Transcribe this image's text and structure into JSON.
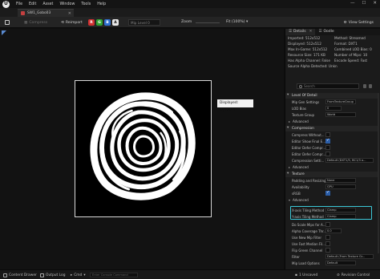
{
  "menubar": {
    "items": [
      "File",
      "Edit",
      "Asset",
      "Window",
      "Tools",
      "Help"
    ],
    "window_controls": [
      "—",
      "☐",
      "✕"
    ]
  },
  "tab": {
    "title": "SW1_Gobo03",
    "close": "✕"
  },
  "toolbar": {
    "save_icon": "save-icon",
    "compress_label": "Compress",
    "reimport_label": "Reimport",
    "channels": [
      {
        "label": "R",
        "color": "#d03030"
      },
      {
        "label": "G",
        "color": "#30a030"
      },
      {
        "label": "B",
        "color": "#2f6fd0"
      },
      {
        "label": "A",
        "color": "#e8e8e8"
      }
    ],
    "mip_placeholder": "Mip Level 0",
    "zoom_label": "Zoom",
    "zoom_value": "Fit (100%)",
    "view_settings_label": "View Settings"
  },
  "viewport": {
    "displayed_tag": "Displayed: 512x512"
  },
  "panel": {
    "tabs": [
      {
        "label": "Details",
        "active": true
      },
      {
        "label": "Oodle",
        "active": false
      }
    ],
    "info_lines": [
      "Imported: 512x512",
      "Method: Streamed",
      "Displayed: 512x512",
      "Format: DXT1",
      "Max In-Game: 512x512",
      "Combined LOD Bias: 0",
      "Resource Size: 171 KB",
      "Number of Mips: 10",
      "Has Alpha Channel: False",
      "Encode Speed: Fast",
      "Source Alpha Detected: Unkn"
    ],
    "search_placeholder": "Search",
    "sections": {
      "lod": "Level Of Detail",
      "compression": "Compression",
      "texture": "Texture"
    },
    "lod_props": [
      {
        "label": "Mip Gen Settings",
        "value": "FromTextureGroup"
      },
      {
        "label": "LOD Bias",
        "value": "0"
      },
      {
        "label": "Texture Group",
        "value": "World"
      }
    ],
    "advanced_label": "Advanced",
    "compression_props": [
      {
        "label": "Compress Without...",
        "checked": false
      },
      {
        "label": "Editor Show Final E...",
        "checked": true
      },
      {
        "label": "Editor Defer Compr...",
        "checked": false
      },
      {
        "label": "Editor Defer Compr...",
        "checked": false
      }
    ],
    "compression_settings": {
      "label": "Compression Setti...",
      "value": "Default (DXT1/5, BC1/3 o..."
    },
    "texture_props": [
      {
        "label": "Padding and Resizing",
        "value": "None"
      },
      {
        "label": "Availability",
        "value": "GPU"
      }
    ],
    "srgb": {
      "label": "sRGB",
      "checked": true
    },
    "tiling": [
      {
        "label": "X-axis Tiling Method",
        "value": "Clamp"
      },
      {
        "label": "Y-axis Tiling Method",
        "value": "Clamp"
      }
    ],
    "bottom_props": [
      {
        "label": "Do Scale Mips for A...",
        "type": "check",
        "checked": false
      },
      {
        "label": "Alpha Coverage Thr...",
        "type": "text",
        "value": "0.0"
      },
      {
        "label": "Use New Mip Filter",
        "type": "check",
        "checked": false
      },
      {
        "label": "Use Fast Median Fil...",
        "type": "check",
        "checked": false
      },
      {
        "label": "Flip Green Channel",
        "type": "check",
        "checked": false
      },
      {
        "label": "Filter",
        "type": "text",
        "value": "Default (From Texture Gr..."
      },
      {
        "label": "Mip Load Options",
        "type": "text",
        "value": "Default"
      }
    ]
  },
  "statusbar": {
    "content_drawer": "Content Drawer",
    "output_log": "Output Log",
    "cmd": "Cmd",
    "cmd_placeholder": "Enter Console Command",
    "unsaved": "1 Unsaved",
    "revision_control": "Revision Control"
  }
}
